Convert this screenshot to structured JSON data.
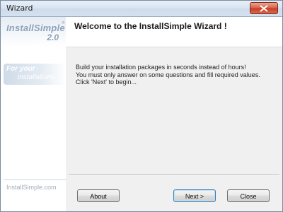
{
  "window": {
    "title": "Wizard"
  },
  "sidebar": {
    "brand_name": "InstallSimple",
    "brand_reg": "®",
    "brand_version": "2.0",
    "slogan_line1": "For your",
    "slogan_line2": "installations",
    "url": "InstallSimple.com"
  },
  "header": {
    "title": "Welcome to the InstallSimple Wizard !"
  },
  "body": {
    "lines": [
      "Build your installation packages in seconds instead of hours!",
      "You must only answer on some questions and fill required values.",
      "Click 'Next' to begin..."
    ]
  },
  "buttons": {
    "about": "About",
    "next": "Next >",
    "close": "Close"
  },
  "icons": {
    "close": "close-icon"
  },
  "colors": {
    "close_button": "#c63b22",
    "brand": "#8ea2b9",
    "default_button_border": "#3c7fb1"
  }
}
